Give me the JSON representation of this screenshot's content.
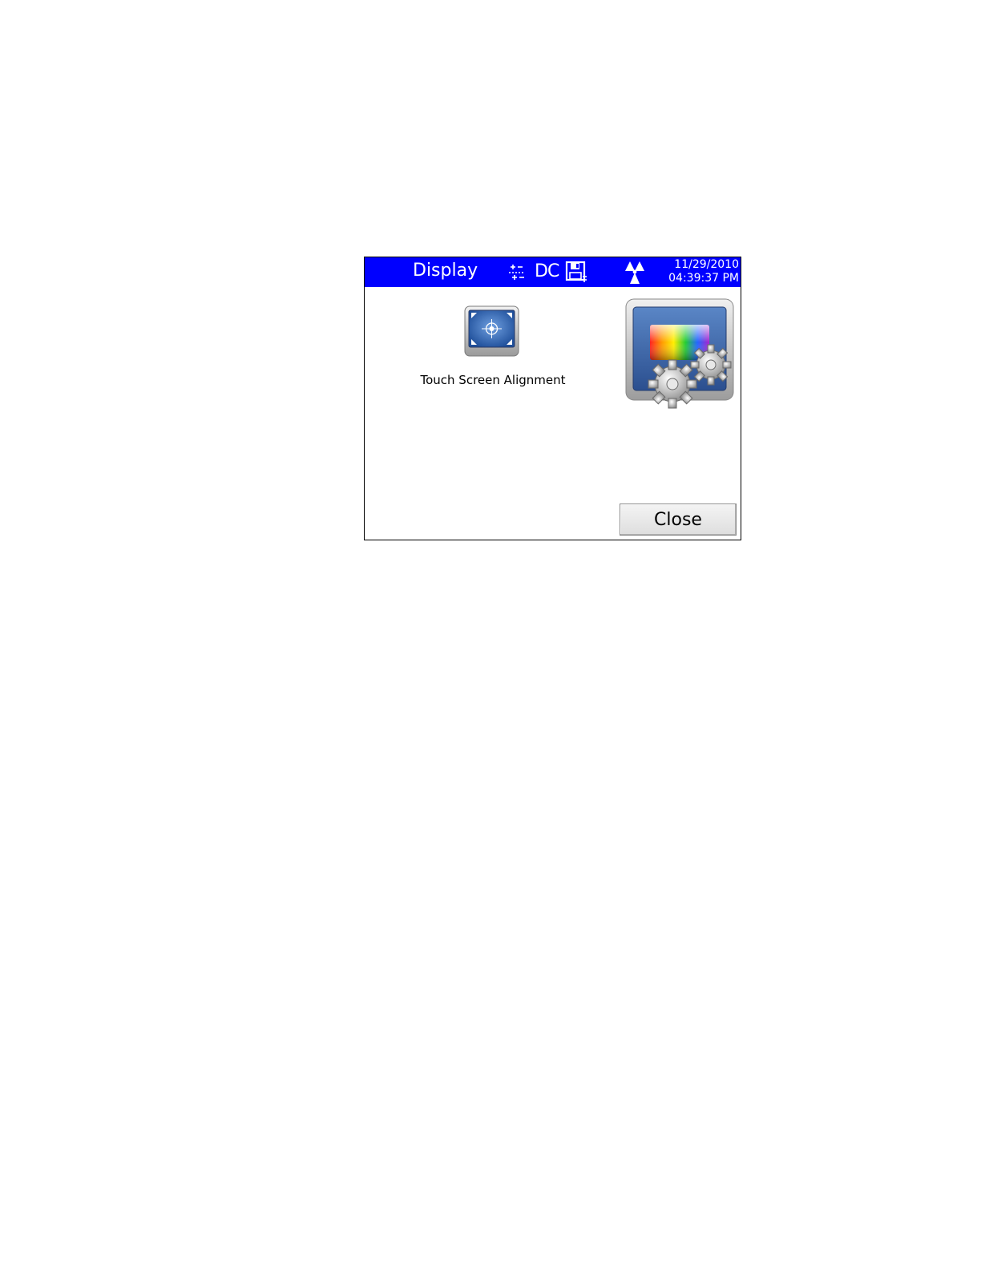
{
  "titlebar": {
    "title": "Display",
    "mode": "DC",
    "date": "11/29/2010",
    "time": "04:39:37 PM",
    "color": "#0000ff"
  },
  "icons": {
    "settings": "adjust-icon",
    "save": "save-disk-icon",
    "radiation": "radiation-icon",
    "alignment": "touch-screen-alignment-icon",
    "display_settings": "display-settings-icon"
  },
  "main": {
    "tile_label": "Touch Screen Alignment"
  },
  "footer": {
    "close_label": "Close"
  }
}
